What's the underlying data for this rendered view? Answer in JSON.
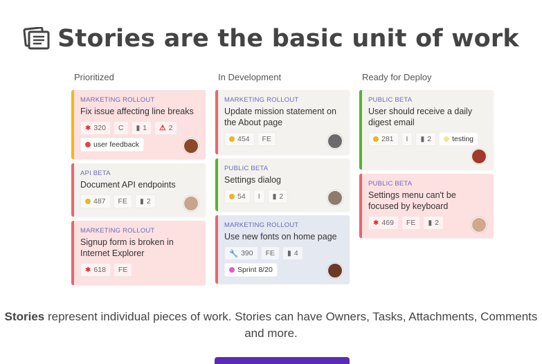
{
  "header": {
    "title": "Stories are the basic unit of work",
    "icon": "stories-icon"
  },
  "columns": [
    {
      "label": "Prioritized",
      "cards": [
        {
          "epic": "MARKETING ROLLOUT",
          "title": "Fix issue affecting line breaks",
          "points": "320",
          "type": "C",
          "est": "1",
          "alerts": "2",
          "label": "user feedback"
        },
        {
          "epic": "API BETA",
          "title": "Document API endpoints",
          "points": "487",
          "type": "FE",
          "est": "2"
        },
        {
          "epic": "MARKETING ROLLOUT",
          "title": "Signup form is broken in Internet Explorer",
          "points": "618",
          "type": "FE"
        }
      ]
    },
    {
      "label": "In Development",
      "cards": [
        {
          "epic": "MARKETING ROLLOUT",
          "title": "Update mission statement on the About page",
          "points": "454",
          "type": "FE"
        },
        {
          "epic": "PUBLIC BETA",
          "title": "Settings dialog",
          "points": "54",
          "type": "I",
          "est": "2"
        },
        {
          "epic": "MARKETING ROLLOUT",
          "title": "Use new fonts on home page",
          "points": "390",
          "type": "FE",
          "est": "4",
          "label": "Sprint 8/20"
        }
      ]
    },
    {
      "label": "Ready for Deploy",
      "cards": [
        {
          "epic": "PUBLIC BETA",
          "title": "User should receive a daily digest email",
          "points": "281",
          "type": "I",
          "est": "2",
          "label": "testing"
        },
        {
          "epic": "PUBLIC BETA",
          "title": "Settings menu can't be focused by keyboard",
          "points": "469",
          "type": "FE",
          "est": "2"
        }
      ]
    }
  ],
  "caption": {
    "bold": "Stories",
    "rest": " represent individual pieces of work. Stories can have Owners, Tasks, Attachments, Comments and more."
  },
  "colors": {
    "red_card": "#fde0e0",
    "stripe_red": "#f0636b",
    "stripe_green": "#5ab12b",
    "stripe_yellow": "#f4b61c",
    "epic": "#6b6bb8",
    "cta": "#5b2bb6"
  }
}
